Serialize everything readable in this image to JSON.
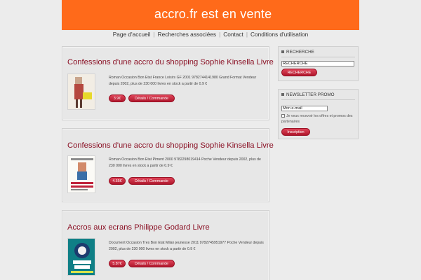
{
  "header": {
    "title": "accro.fr est en vente"
  },
  "nav": [
    {
      "label": "Page d'accueil"
    },
    {
      "label": "Recherches associées"
    },
    {
      "label": "Contact"
    },
    {
      "label": "Conditions d'utilisation"
    }
  ],
  "products": [
    {
      "title": "Confessions d'une accro du shopping Sophie Kinsella Livre",
      "description": "Roman Occasion Bon Etat France Loisirs GF 2001 9782744141980 Grand Format Vendeur depuis 2002, plus de 230 000 livres en stock a partir de 0.9 €",
      "price": "3.9€",
      "details_label": "Détails / Commande",
      "thumb_icon": "book-cover-shopping-icon"
    },
    {
      "title": "Confessions d'une accro du shopping Sophie Kinsella Livre",
      "description": "Roman Occasion Bon Etat Piment 2000 9782298019414 Poche Vendeur depuis 2002, plus de 230 000 livres en stock a partir de 0.9 €",
      "price": "4.55€",
      "details_label": "Détails / Commande",
      "thumb_icon": "book-cover-confessions-icon"
    },
    {
      "title": "Accros aux ecrans Philippe Godard Livre",
      "description": "Document Occasion Tres Bon Etat Milan jeunesse 2011 9782745951977 Poche Vendeur depuis 2002, plus de 230 000 livres en stock a partir de 0.9 €",
      "price": "5.87€",
      "details_label": "Détails / Commande",
      "thumb_icon": "book-cover-ecrans-icon"
    }
  ],
  "sidebar": {
    "search": {
      "title": "RECHERCHE",
      "input_value": "RECHERCHE",
      "button_label": "RECHERCHE"
    },
    "newsletter": {
      "title": "NEWSLETTER PROMO",
      "email_value": "Mon e-mail",
      "checkbox_label": "Je veux recevoir les offres et promos des partenaires",
      "button_label": "Inscription"
    }
  },
  "colors": {
    "header_bg": "#ff6a1a",
    "title_red": "#8a1024",
    "button_red": "#c41f36"
  }
}
